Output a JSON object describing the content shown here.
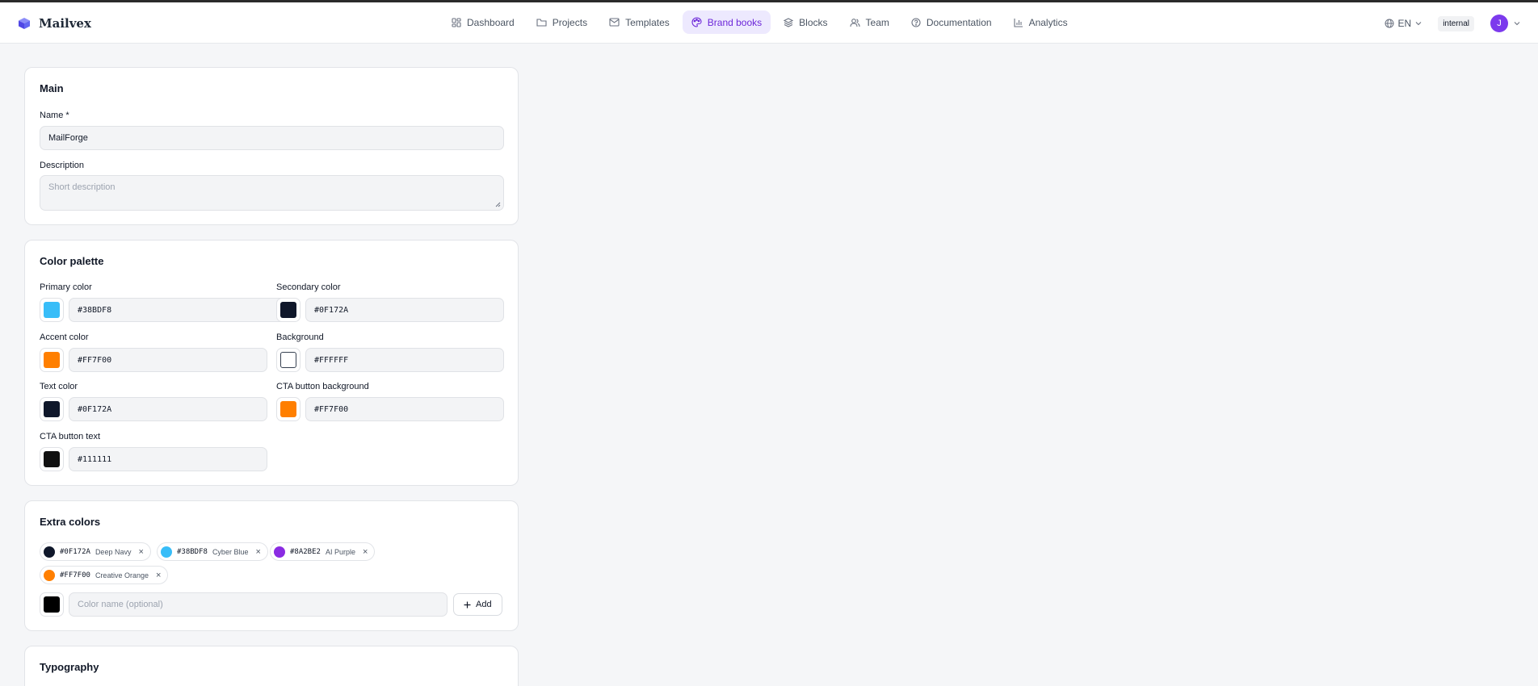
{
  "app": {
    "name": "Mailvex"
  },
  "nav": {
    "items": [
      {
        "label": "Dashboard",
        "icon": "dashboard-icon"
      },
      {
        "label": "Projects",
        "icon": "folder-icon"
      },
      {
        "label": "Templates",
        "icon": "mail-icon"
      },
      {
        "label": "Brand books",
        "icon": "palette-icon",
        "active": true
      },
      {
        "label": "Blocks",
        "icon": "layers-icon"
      },
      {
        "label": "Team",
        "icon": "users-icon"
      },
      {
        "label": "Documentation",
        "icon": "help-icon"
      },
      {
        "label": "Analytics",
        "icon": "chart-icon"
      }
    ],
    "language": "EN",
    "badge": "internal",
    "avatar_initial": "J"
  },
  "main": {
    "title": "Main",
    "name_label": "Name *",
    "name_value": "MailForge",
    "description_label": "Description",
    "description_placeholder": "Short description"
  },
  "palette": {
    "title": "Color palette",
    "colors": [
      {
        "label": "Primary color",
        "value": "#38BDF8",
        "swatch": "#38BDF8"
      },
      {
        "label": "Secondary color",
        "value": "#0F172A",
        "swatch": "#0F172A"
      },
      {
        "label": "Accent color",
        "value": "#FF7F00",
        "swatch": "#FF7F00"
      },
      {
        "label": "Background",
        "value": "#FFFFFF",
        "swatch": "#FFFFFF"
      },
      {
        "label": "Text color",
        "value": "#0F172A",
        "swatch": "#0F172A"
      },
      {
        "label": "CTA button background",
        "value": "#FF7F00",
        "swatch": "#FF7F00"
      },
      {
        "label": "CTA button text",
        "value": "#111111",
        "swatch": "#111111"
      }
    ]
  },
  "extra": {
    "title": "Extra colors",
    "chips": [
      {
        "hex": "#0F172A",
        "name": "Deep Navy",
        "color": "#0F172A"
      },
      {
        "hex": "#38BDF8",
        "name": "Cyber Blue",
        "color": "#38BDF8"
      },
      {
        "hex": "#8A2BE2",
        "name": "AI Purple",
        "color": "#8A2BE2"
      },
      {
        "hex": "#FF7F00",
        "name": "Creative Orange",
        "color": "#FF7F00"
      }
    ],
    "new_color_swatch": "#000000",
    "name_placeholder": "Color name (optional)",
    "add_label": "Add",
    "remove_glyph": "×"
  },
  "typography": {
    "title": "Typography"
  },
  "theme": {
    "accent": "#7C3AED",
    "active_nav_bg": "#EDE9FE"
  }
}
